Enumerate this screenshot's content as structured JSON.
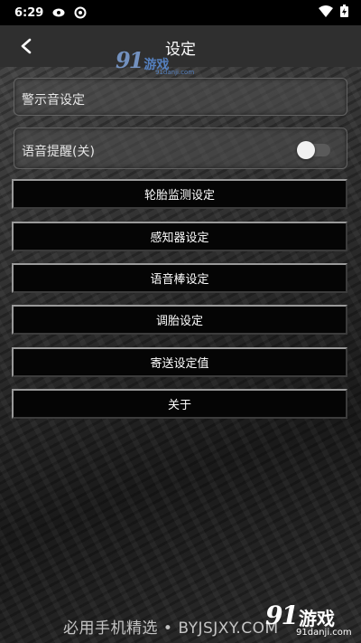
{
  "status_bar": {
    "time": "6:29"
  },
  "header": {
    "title": "设定"
  },
  "watermark_top": {
    "logo": "91",
    "cn": "游戏",
    "sub": "91danji.com"
  },
  "settings": {
    "alert_sound_label": "警示音设定",
    "voice_reminder_label": "语音提醒(关)",
    "voice_reminder_on": false
  },
  "menu": [
    {
      "label": "轮胎监测设定"
    },
    {
      "label": "感知器设定"
    },
    {
      "label": "语音棒设定"
    },
    {
      "label": "调胎设定"
    },
    {
      "label": "寄送设定值"
    },
    {
      "label": "关于"
    }
  ],
  "bottom_watermark": {
    "text": "必用手机精选 • BYJSJXY.COM",
    "logo_num": "91",
    "logo_cn": "游戏",
    "logo_sub": "91danji.com"
  }
}
